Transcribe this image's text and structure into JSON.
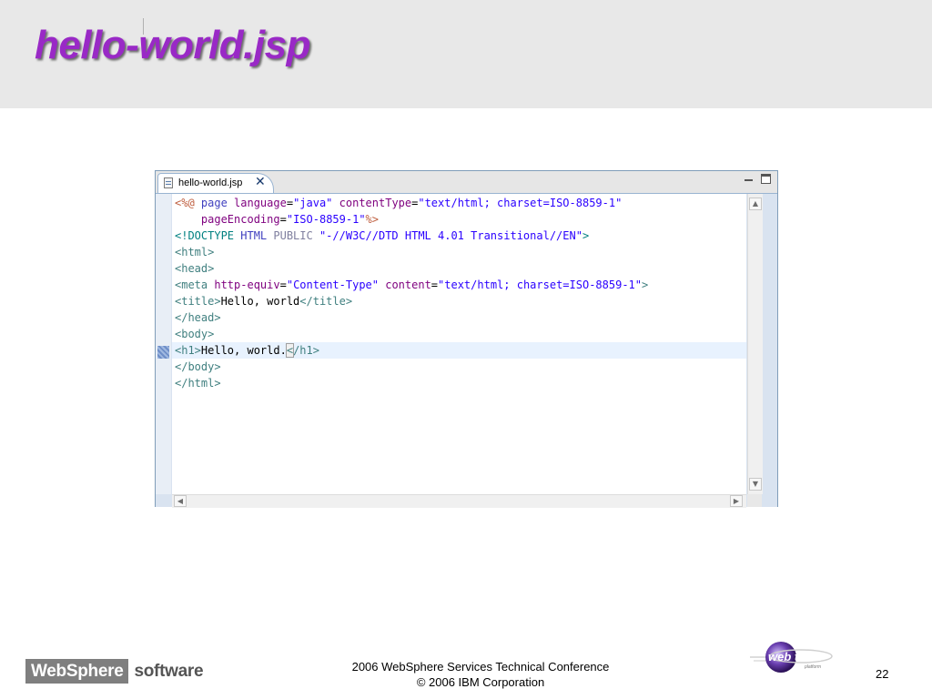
{
  "slide": {
    "title": "hello-world.jsp",
    "page_number": "22"
  },
  "editor": {
    "tab_label": "hello-world.jsp",
    "tab_close_glyph": "✕",
    "tab_icon": "jsp-file-icon",
    "minimize_icon": "minimize-icon",
    "maximize_icon": "maximize-icon"
  },
  "code": {
    "highlight_line_index": 9,
    "lines": [
      [
        {
          "t": "<%@ ",
          "c": "jsp"
        },
        {
          "t": "page ",
          "c": "kw"
        },
        {
          "t": "language",
          "c": "attr"
        },
        {
          "t": "=",
          "c": "txt"
        },
        {
          "t": "\"java\" ",
          "c": "val"
        },
        {
          "t": "contentType",
          "c": "attr"
        },
        {
          "t": "=",
          "c": "txt"
        },
        {
          "t": "\"text/html; charset=ISO-8859-1\"",
          "c": "val"
        }
      ],
      [
        {
          "t": "    ",
          "c": "txt"
        },
        {
          "t": "pageEncoding",
          "c": "attr"
        },
        {
          "t": "=",
          "c": "txt"
        },
        {
          "t": "\"ISO-8859-1\"",
          "c": "val"
        },
        {
          "t": "%>",
          "c": "jsp"
        }
      ],
      [
        {
          "t": "<!DOCTYPE ",
          "c": "doc"
        },
        {
          "t": "HTML ",
          "c": "kw"
        },
        {
          "t": "PUBLIC ",
          "c": "dt"
        },
        {
          "t": "\"-//W3C//DTD HTML 4.01 Transitional//EN\"",
          "c": "val"
        },
        {
          "t": ">",
          "c": "doc"
        }
      ],
      [
        {
          "t": "<html>",
          "c": "tag"
        }
      ],
      [
        {
          "t": "<head>",
          "c": "tag"
        }
      ],
      [
        {
          "t": "<meta ",
          "c": "tag"
        },
        {
          "t": "http-equiv",
          "c": "attr"
        },
        {
          "t": "=",
          "c": "txt"
        },
        {
          "t": "\"Content-Type\" ",
          "c": "val"
        },
        {
          "t": "content",
          "c": "attr"
        },
        {
          "t": "=",
          "c": "txt"
        },
        {
          "t": "\"text/html; charset=ISO-8859-1\"",
          "c": "val"
        },
        {
          "t": ">",
          "c": "tag"
        }
      ],
      [
        {
          "t": "<title>",
          "c": "tag"
        },
        {
          "t": "Hello, world",
          "c": "txt"
        },
        {
          "t": "</title>",
          "c": "tag"
        }
      ],
      [
        {
          "t": "</head>",
          "c": "tag"
        }
      ],
      [
        {
          "t": "<body>",
          "c": "tag"
        }
      ],
      [
        {
          "t": "<h1>",
          "c": "tag"
        },
        {
          "t": "Hello, world.",
          "c": "txt"
        },
        {
          "t": "<",
          "c": "tag",
          "cursor": true
        },
        {
          "t": "/h1>",
          "c": "tag"
        }
      ],
      [
        {
          "t": "</body>",
          "c": "tag"
        }
      ],
      [
        {
          "t": "</html>",
          "c": "tag"
        }
      ]
    ]
  },
  "scrollbars": {
    "up_glyph": "▲",
    "down_glyph": "▼",
    "left_glyph": "◀",
    "right_glyph": "▶"
  },
  "footer": {
    "brand_box": "WebSphere",
    "brand_rest": "software",
    "conference_line": "2006 WebSphere Services Technical Conference",
    "copyright_line": "© 2006 IBM Corporation",
    "webtools_logo": {
      "text": "web tools",
      "sub": "platform",
      "icon": "webtools-logo-icon"
    }
  }
}
